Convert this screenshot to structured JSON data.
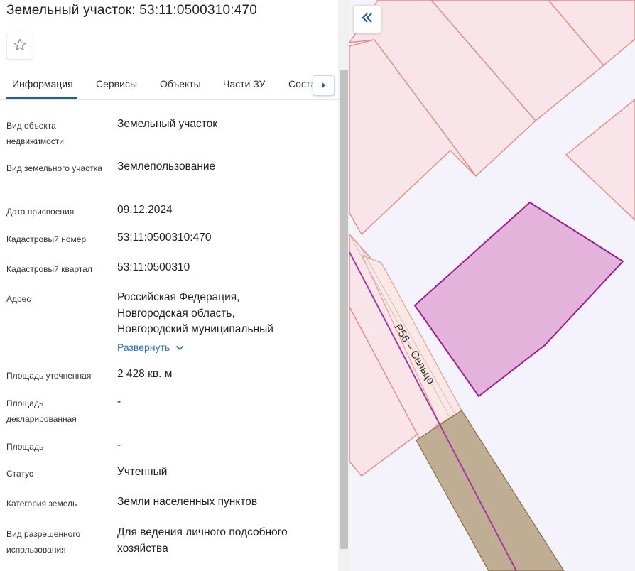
{
  "title": "Земельный участок: 53:11:0500310:470",
  "favorite": {
    "icon": "star-outline-icon"
  },
  "tabs": [
    {
      "label": "Информация",
      "active": true
    },
    {
      "label": "Сервисы"
    },
    {
      "label": "Объекты"
    },
    {
      "label": "Части ЗУ"
    },
    {
      "label": "Соста"
    }
  ],
  "tabs_next_icon": "caret-right-icon",
  "fields": [
    {
      "label": "Вид объекта недвижимости",
      "value": "Земельный участок"
    },
    {
      "label": "Вид земельного участка",
      "value": "Землепользование"
    },
    {
      "label": "Дата присвоения",
      "value": "09.12.2024"
    },
    {
      "label": "Кадастровый номер",
      "value": "53:11:0500310:470"
    },
    {
      "label": "Кадастровый квартал",
      "value": "53:11:0500310"
    },
    {
      "label": "Адрес",
      "value": "Российская Федерация, Новгородская область, Новгородский муниципальный"
    },
    {
      "label": "Площадь уточненная",
      "value": "2 428 кв. м"
    },
    {
      "label": "Площадь декларированная",
      "value": "-"
    },
    {
      "label": "Площадь",
      "value": "-"
    },
    {
      "label": "Статус",
      "value": "Учтенный"
    },
    {
      "label": "Категория земель",
      "value": "Земли населенных пунктов"
    },
    {
      "label": "Вид разрешенного использования",
      "value": "Для ведения личного подсобного хозяйства"
    }
  ],
  "expand_link": "Развернуть",
  "map": {
    "road_label": "Р56 – Сельцо",
    "collapse_icon": "double-chevron-left-icon",
    "colors": {
      "background": "#f4f3fb",
      "parcel_fill": "#f9e5e9",
      "parcel_stroke": "#e58a7f",
      "selected_fill": "#e4b3dc",
      "selected_stroke": "#9b1d93",
      "road_fill": "#bfad94",
      "road_stroke": "#8a6e45"
    }
  },
  "colors": {
    "accent": "#1f5fa8",
    "link": "#2b73b8"
  }
}
